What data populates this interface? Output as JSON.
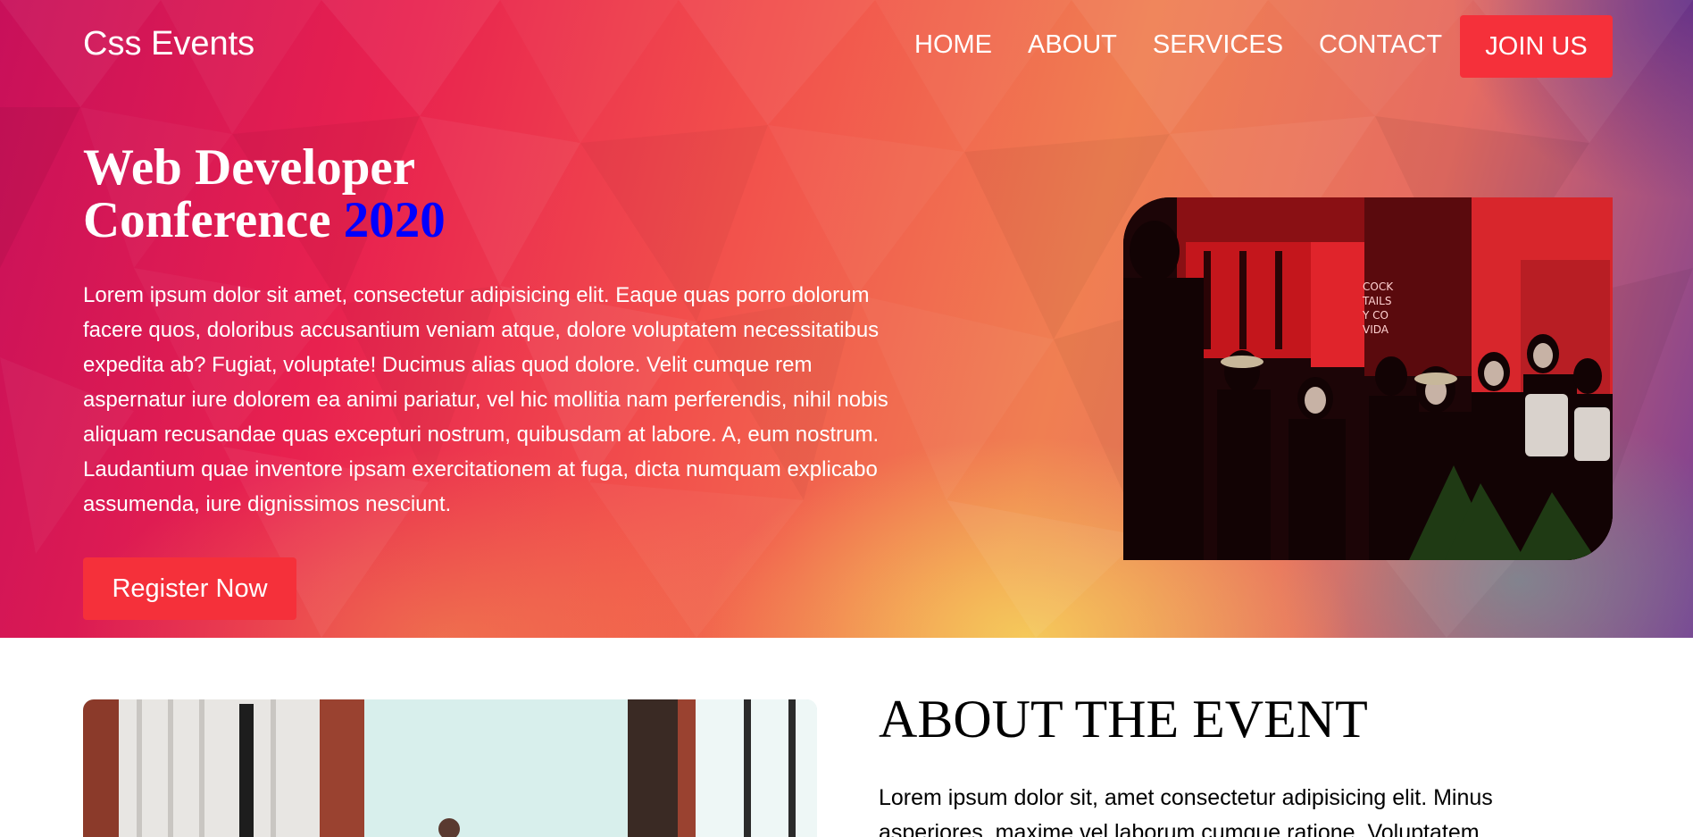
{
  "nav": {
    "brand": "Css Events",
    "links": [
      "HOME",
      "ABOUT",
      "SERVICES",
      "CONTACT"
    ],
    "join_label": "JOIN US"
  },
  "hero": {
    "title_line1": "Web Developer",
    "title_line2": "Conference",
    "title_year": "2020",
    "paragraph": "Lorem ipsum dolor sit amet, consectetur adipisicing elit. Eaque quas porro dolorum facere quos, doloribus accusantium veniam atque, dolore voluptatem necessitatibus expedita ab? Fugiat, voluptate! Ducimus alias quod dolore. Velit cumque rem aspernatur iure dolorem ea animi pariatur, vel hic mollitia nam perferendis, nihil nobis aliquam recusandae quas excepturi nostrum, quibusdam at labore. A, eum nostrum. Laudantium quae inventore ipsam exercitationem at fuga, dicta numquam explicabo assumenda, iure dignissimos nesciunt.",
    "register_label": "Register Now",
    "photo_sign": [
      "COCK",
      "TAILS",
      "Y CO",
      "VIDA"
    ]
  },
  "about": {
    "title": "ABOUT THE EVENT",
    "paragraph": "Lorem ipsum dolor sit, amet consectetur adipisicing elit. Minus asperiores, maxime vel laborum cumque ratione. Voluptatem"
  },
  "colors": {
    "accent": "#f5303a",
    "year_highlight": "#0000ff",
    "hero_gradient": [
      "#c8105a",
      "#e8214f",
      "#f07f52",
      "#7a3f94"
    ]
  }
}
